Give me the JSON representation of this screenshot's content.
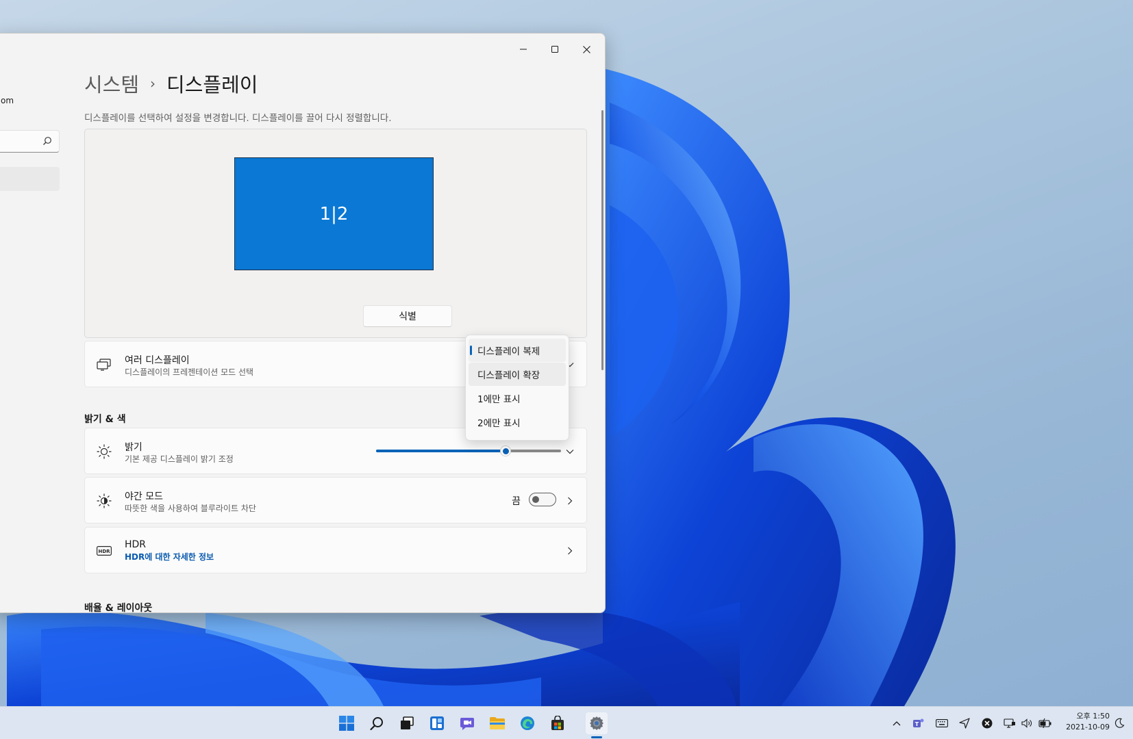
{
  "window": {
    "controls": {
      "minimize": "minimize",
      "maximize": "maximize",
      "close": "close"
    }
  },
  "nav": {
    "account_email_fragment": "om",
    "search_placeholder": ""
  },
  "breadcrumb": {
    "parent": "시스템",
    "separator": "›",
    "current": "디스플레이"
  },
  "description": "디스플레이를 선택하여 설정을 변경합니다. 디스플레이를 끌어 다시 정렬합니다.",
  "arrangement": {
    "monitor_label": "1|2",
    "identify_button": "식별"
  },
  "multi_display": {
    "title": "여러 디스플레이",
    "subtitle": "디스플레이의 프레젠테이션 모드 선택"
  },
  "dropdown": {
    "options": [
      "디스플레이 복제",
      "디스플레이 확장",
      "1에만 표시",
      "2에만 표시"
    ],
    "selected_index": 0
  },
  "section_brightness": "밝기 & 색",
  "brightness": {
    "title": "밝기",
    "subtitle": "기본 제공 디스플레이 밝기 조정",
    "value_percent": 70
  },
  "night_light": {
    "title": "야간 모드",
    "subtitle": "따뜻한 색을 사용하여 블루라이트 차단",
    "state_label": "끔",
    "on": false
  },
  "hdr": {
    "title": "HDR",
    "link": "HDR에 대한 자세한 정보"
  },
  "section_scale": "배율 & 레이아웃",
  "taskbar": {
    "apps": [
      "start-icon",
      "search-icon",
      "task-view-icon",
      "widgets-icon",
      "chat-icon",
      "file-explorer-icon",
      "edge-icon",
      "store-icon",
      "settings-icon"
    ],
    "active_app": "settings-icon",
    "clock": {
      "period_time": "오후 1:50",
      "date": "2021-10-09"
    }
  },
  "colors": {
    "accent": "#0a63b8",
    "monitor_fill": "#0a78d4",
    "window_bg": "#f3f3f3",
    "card_bg": "#fbfbfb",
    "taskbar_bg": "#dce5f1"
  }
}
